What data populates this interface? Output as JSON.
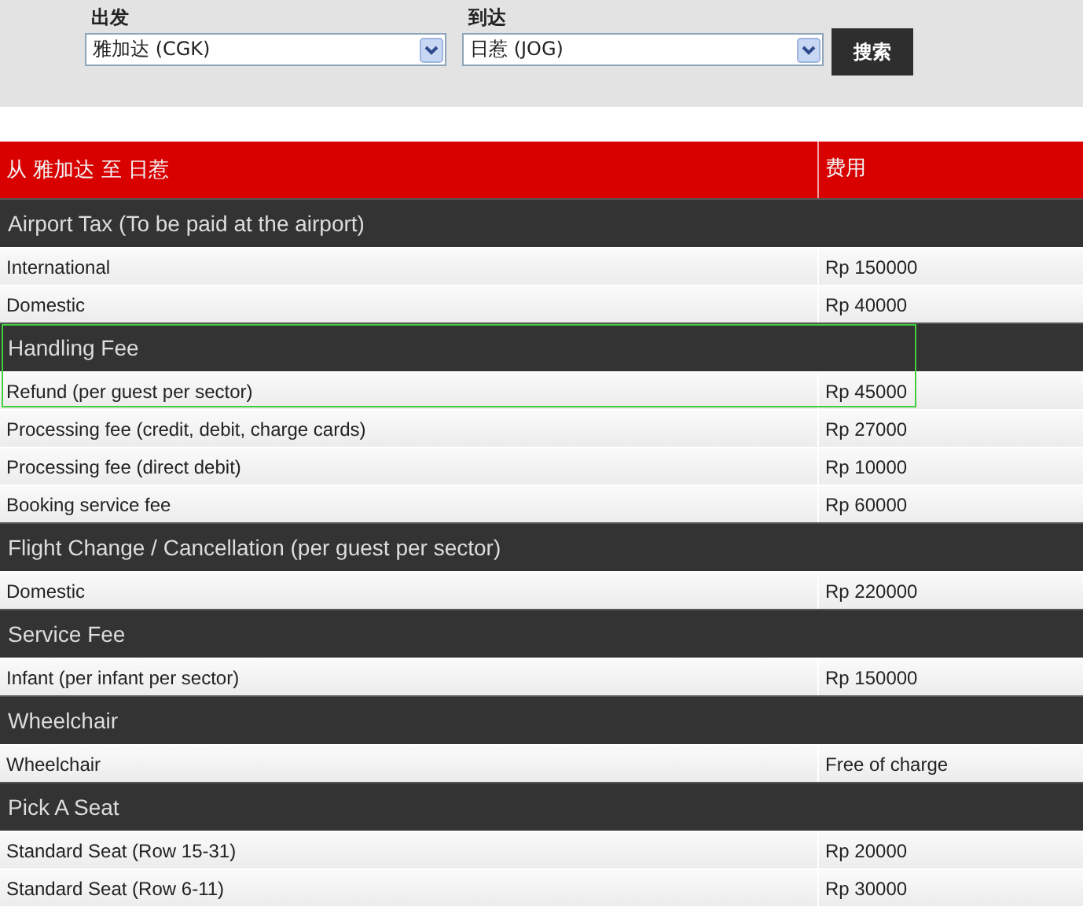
{
  "search": {
    "from": {
      "label": "出发",
      "value": "雅加达  (CGK)"
    },
    "to": {
      "label": "到达",
      "value": "日惹  (JOG)"
    },
    "button": "搜索"
  },
  "table": {
    "columns": [
      "从  雅加达  至  日惹",
      "费用"
    ],
    "sections": [
      {
        "title": "Airport Tax (To be paid at the airport)",
        "highlighted": false,
        "rows": [
          {
            "item": "International",
            "fee": "Rp 150000"
          },
          {
            "item": "Domestic",
            "fee": "Rp 40000"
          }
        ]
      },
      {
        "title": "Handling Fee",
        "highlighted": true,
        "rows": [
          {
            "item": "Refund (per guest per sector)",
            "fee": "Rp 45000"
          },
          {
            "item": "Processing fee (credit, debit, charge cards)",
            "fee": "Rp 27000"
          },
          {
            "item": "Processing fee (direct debit)",
            "fee": "Rp 10000"
          },
          {
            "item": "Booking service fee",
            "fee": "Rp 60000"
          }
        ]
      },
      {
        "title": "Flight Change / Cancellation (per guest per sector)",
        "highlighted": false,
        "rows": [
          {
            "item": "Domestic",
            "fee": "Rp 220000"
          }
        ]
      },
      {
        "title": "Service Fee",
        "highlighted": false,
        "rows": [
          {
            "item": "Infant (per infant per sector)",
            "fee": "Rp 150000"
          }
        ]
      },
      {
        "title": "Wheelchair",
        "highlighted": false,
        "rows": [
          {
            "item": "Wheelchair",
            "fee": "Free of charge"
          }
        ]
      },
      {
        "title": "Pick A Seat",
        "highlighted": false,
        "rows": [
          {
            "item": "Standard Seat (Row 15-31)",
            "fee": "Rp 20000"
          },
          {
            "item": "Standard Seat (Row 6-11)",
            "fee": "Rp 30000"
          }
        ]
      }
    ]
  }
}
